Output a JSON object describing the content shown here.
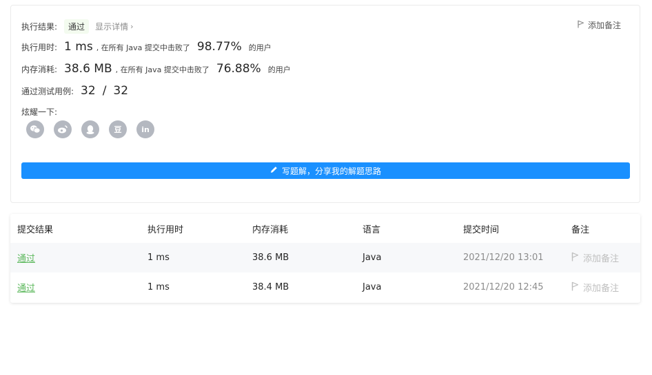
{
  "result": {
    "status_label": "执行结果:",
    "status_value": "通过",
    "details_link": "显示详情",
    "add_note": "添加备注"
  },
  "runtime": {
    "label": "执行用时:",
    "value": "1 ms",
    "beat_prefix": ", 在所有 Java 提交中击败了",
    "percent": "98.77%",
    "suffix": "的用户"
  },
  "memory": {
    "label": "内存消耗:",
    "value": "38.6 MB",
    "beat_prefix": ", 在所有 Java 提交中击败了",
    "percent": "76.88%",
    "suffix": "的用户"
  },
  "tests": {
    "label": "通过测试用例:",
    "passed": "32",
    "separator": "/",
    "total": "32"
  },
  "share": {
    "label": "炫耀一下:",
    "icons": [
      "wechat-icon",
      "weibo-icon",
      "qq-icon",
      "douban-icon",
      "linkedin-icon"
    ],
    "douban_glyph": "豆",
    "linkedin_glyph": "in"
  },
  "write_solution": {
    "label": "写题解，分享我的解题思路",
    "icon": "pencil-icon",
    "color": "#1a90ff"
  },
  "submissions": {
    "headers": [
      "提交结果",
      "执行用时",
      "内存消耗",
      "语言",
      "提交时间",
      "备注"
    ],
    "rows": [
      {
        "result": "通过",
        "time": "1 ms",
        "memory": "38.6 MB",
        "language": "Java",
        "submitted": "2021/12/20 13:01",
        "note": "添加备注"
      },
      {
        "result": "通过",
        "time": "1 ms",
        "memory": "38.4 MB",
        "language": "Java",
        "submitted": "2021/12/20 12:45",
        "note": "添加备注"
      }
    ]
  },
  "colors": {
    "accent": "#1a90ff",
    "pass_green": "#5cb85c",
    "badge_bg": "#f3fbef",
    "muted": "#8c8c8c"
  }
}
